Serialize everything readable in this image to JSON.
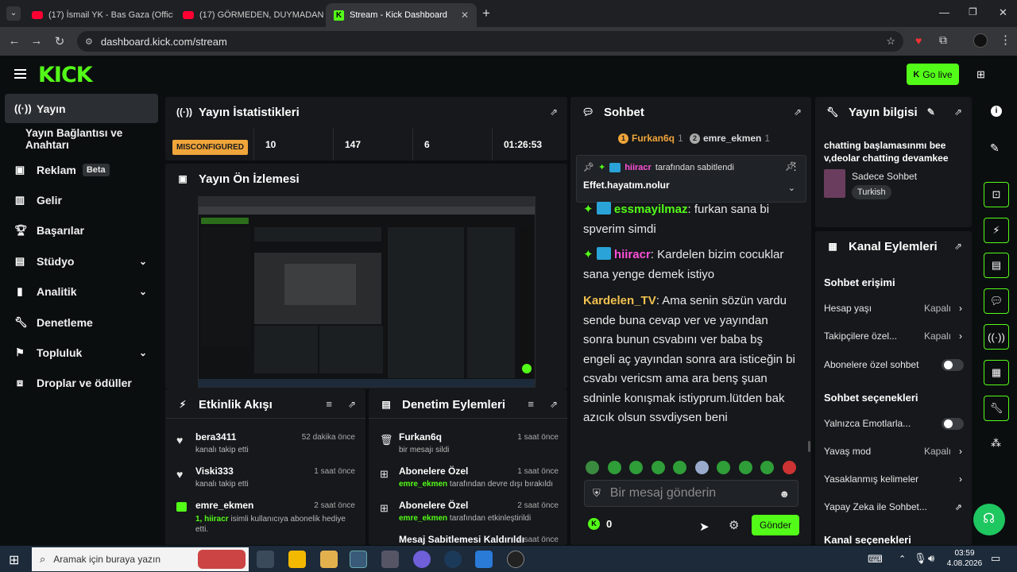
{
  "browser": {
    "tabs": [
      {
        "title": "(17) İsmail YK - Bas Gaza (Offici"
      },
      {
        "title": "(17) GÖRMEDEN, DUYMADAN"
      },
      {
        "title": "Stream - Kick Dashboard"
      }
    ],
    "url": "dashboard.kick.com/stream"
  },
  "header": {
    "logo": "KICK",
    "go_live": "Go live"
  },
  "sidebar": {
    "items": [
      {
        "label": "Yayın"
      },
      {
        "label": "Yayın Bağlantısı ve Anahtarı"
      },
      {
        "label": "Reklam",
        "badge": "Beta"
      },
      {
        "label": "Gelir"
      },
      {
        "label": "Başarılar"
      },
      {
        "label": "Stüdyo"
      },
      {
        "label": "Analitik"
      },
      {
        "label": "Denetleme"
      },
      {
        "label": "Topluluk"
      },
      {
        "label": "Droplar ve ödüller"
      }
    ]
  },
  "stats": {
    "title": "Yayın İstatistikleri",
    "status": "MISCONFIGURED",
    "values": [
      "10",
      "147",
      "6",
      "01:26:53"
    ]
  },
  "preview": {
    "title": "Yayın Ön İzlemesi"
  },
  "activity": {
    "title": "Etkinlik Akışı",
    "items": [
      {
        "name": "bera3411",
        "sub": "kanalı takip etti",
        "time": "52 dakika önce"
      },
      {
        "name": "Viski333",
        "sub": "kanalı takip etti",
        "time": "1 saat önce"
      },
      {
        "name": "emre_ekmen",
        "sub_highlight": "1, hiiracr",
        "sub": " isimli kullanıcıya abonelik hediye etti.",
        "time": "2 saat önce"
      }
    ]
  },
  "moderation": {
    "title": "Denetim Eylemleri",
    "items": [
      {
        "name": "Furkan6q",
        "sub": "bir mesajı sildi",
        "time": "1 saat önce"
      },
      {
        "name": "Abonelere Özel",
        "sub_highlight": "emre_ekmen",
        "sub": " tarafından devre dışı bırakıldı",
        "time": "1 saat önce"
      },
      {
        "name": "Abonelere Özel",
        "sub_highlight": "emre_ekmen",
        "sub": " tarafından etkinleştirildi",
        "time": "2 saat önce"
      },
      {
        "name": "Mesaj Sabitlemesi Kaldırıldı",
        "sub": "",
        "time": "2 saat önce"
      }
    ]
  },
  "chat": {
    "title": "Sohbet",
    "top_users": [
      {
        "rank": "1",
        "name": "Furkan6q",
        "count": "1"
      },
      {
        "rank": "2",
        "name": "emre_ekmen",
        "count": "1"
      }
    ],
    "pinned": {
      "by": "hiiracr",
      "by_suffix": "tarafından sabitlendi",
      "text": "Effet.hayatım.nolur"
    },
    "messages": [
      {
        "user": "essmayilmaz",
        "color": "#53fc18",
        "text": "furkan sana bi spverim simdi"
      },
      {
        "user": "hiiracr",
        "color": "#ff4fd8",
        "text": "Kardelen bizim cocuklar sana yenge demek istiyo"
      },
      {
        "user": "Kardelen_TV",
        "color": "#f2c14e",
        "text": "Ama senin sözün vardu sende buna cevap ver ve yayından sonra bunun csvabını ver baba bş engeli aç yayından sonra ara isticeğin bi csvabı vericsm ama ara benş şuan sdninle konışmak istiyprum.lütden bak azıcık olsun ssvdiysen beni"
      }
    ],
    "input_placeholder": "Bir mesaj gönderin",
    "points": "0",
    "send": "Gönder"
  },
  "stream_info": {
    "title": "Yayın bilgisi",
    "stream_title": "chatting başlamasınmı bee v,deolar chatting devamkee",
    "category": "Sadece Sohbet",
    "language": "Turkish"
  },
  "channel_actions": {
    "title": "Kanal Eylemleri",
    "chat_access_heading": "Sohbet erişimi",
    "account_age": {
      "label": "Hesap yaşı",
      "value": "Kapalı"
    },
    "followers_only": {
      "label": "Takipçilere özel...",
      "value": "Kapalı"
    },
    "subs_only": {
      "label": "Abonelere özel sohbet"
    },
    "chat_options_heading": "Sohbet seçenekleri",
    "emotes_only": {
      "label": "Yalnızca Emotlarla..."
    },
    "slow_mode": {
      "label": "Yavaş mod",
      "value": "Kapalı"
    },
    "banned_words": {
      "label": "Yasaklanmış kelimeler"
    },
    "ai": {
      "label": "Yapay Zeka ile Sohbet..."
    },
    "channel_settings_heading": "Kanal seçenekleri"
  },
  "taskbar": {
    "search_placeholder": "Aramak için buraya yazın",
    "time": "03:59",
    "date": "4.08.2026"
  },
  "colors": {
    "accent": "#53fc18",
    "panel": "#16181b",
    "bg": "#0b0e0f",
    "warning": "#f0a53a"
  }
}
